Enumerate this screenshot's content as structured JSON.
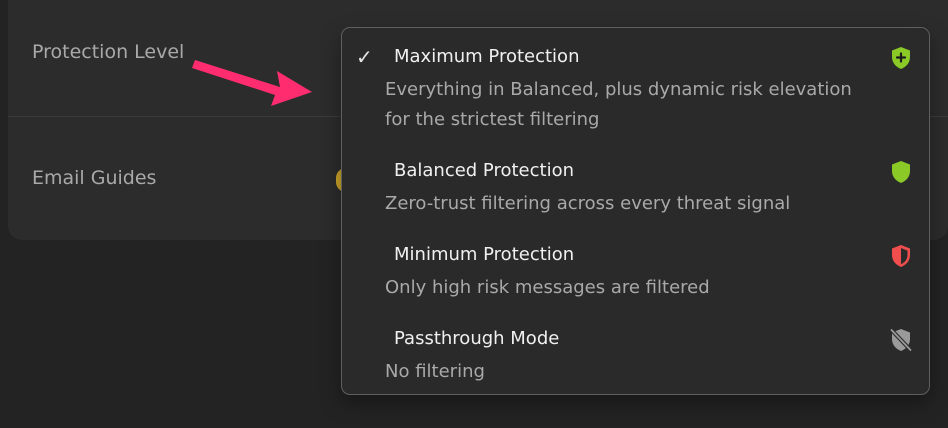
{
  "settings": {
    "protection_level_label": "Protection Level",
    "email_guides_label": "Email Guides"
  },
  "dropdown": {
    "selected_check": "✓",
    "options": [
      {
        "title": "Maximum Protection",
        "description": "Everything in Balanced, plus dynamic risk elevation for the strictest filtering",
        "icon": "shield-plus-icon",
        "icon_color": "#8ac926",
        "selected": true
      },
      {
        "title": "Balanced Protection",
        "description": "Zero-trust filtering across every threat signal",
        "icon": "shield-icon",
        "icon_color": "#8ac926",
        "selected": false
      },
      {
        "title": "Minimum Protection",
        "description": "Only high risk messages are filtered",
        "icon": "shield-half-icon",
        "icon_color": "#f04e4e",
        "selected": false
      },
      {
        "title": "Passthrough Mode",
        "description": "No filtering",
        "icon": "shield-off-icon",
        "icon_color": "#9a9a9a",
        "selected": false
      }
    ]
  },
  "colors": {
    "annotation_arrow": "#ff2d6f",
    "toggle_accent": "#c9a227"
  }
}
